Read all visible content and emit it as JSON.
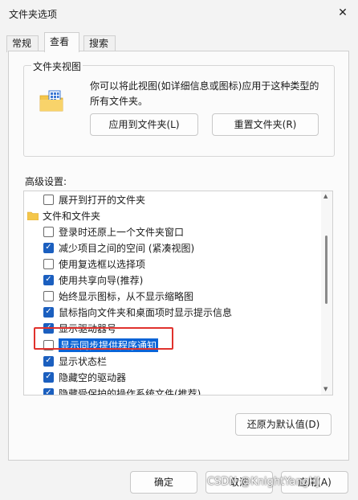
{
  "window": {
    "title": "文件夹选项",
    "close_glyph": "✕"
  },
  "tabs": [
    {
      "label": "常规"
    },
    {
      "label": "查看"
    },
    {
      "label": "搜索"
    }
  ],
  "folder_view": {
    "legend": "文件夹视图",
    "description": "你可以将此视图(如详细信息或图标)应用于这种类型的所有文件夹。",
    "apply_button": "应用到文件夹(L)",
    "reset_button": "重置文件夹(R)"
  },
  "advanced": {
    "label": "高级设置:",
    "items": [
      {
        "label": "展开到打开的文件夹",
        "type": "checkbox",
        "checked": false
      },
      {
        "label": "文件和文件夹",
        "type": "folder"
      },
      {
        "label": "登录时还原上一个文件夹窗口",
        "type": "checkbox",
        "checked": false
      },
      {
        "label": "减少项目之间的空间 (紧凑视图)",
        "type": "checkbox",
        "checked": true
      },
      {
        "label": "使用复选框以选择项",
        "type": "checkbox",
        "checked": false
      },
      {
        "label": "使用共享向导(推荐)",
        "type": "checkbox",
        "checked": true
      },
      {
        "label": "始终显示图标，从不显示缩略图",
        "type": "checkbox",
        "checked": false
      },
      {
        "label": "鼠标指向文件夹和桌面项时显示提示信息",
        "type": "checkbox",
        "checked": true
      },
      {
        "label": "显示驱动器号",
        "type": "checkbox",
        "checked": true
      },
      {
        "label": "显示同步提供程序通知",
        "type": "checkbox",
        "checked": false,
        "highlighted": true
      },
      {
        "label": "显示状态栏",
        "type": "checkbox",
        "checked": true
      },
      {
        "label": "隐藏空的驱动器",
        "type": "checkbox",
        "checked": true
      },
      {
        "label": "隐藏受保护的操作系统文件(推荐)",
        "type": "checkbox",
        "checked": true
      }
    ],
    "restore_button": "还原为默认值(D)"
  },
  "footer": {
    "ok_button": "确定",
    "cancel_button": "取消",
    "apply_button": "应用(A)"
  },
  "watermark": "CSDN @KnightYangHJ",
  "colors": {
    "accent": "#1b5fbf",
    "selection": "#0a64d6",
    "annotation": "#e0322d"
  }
}
